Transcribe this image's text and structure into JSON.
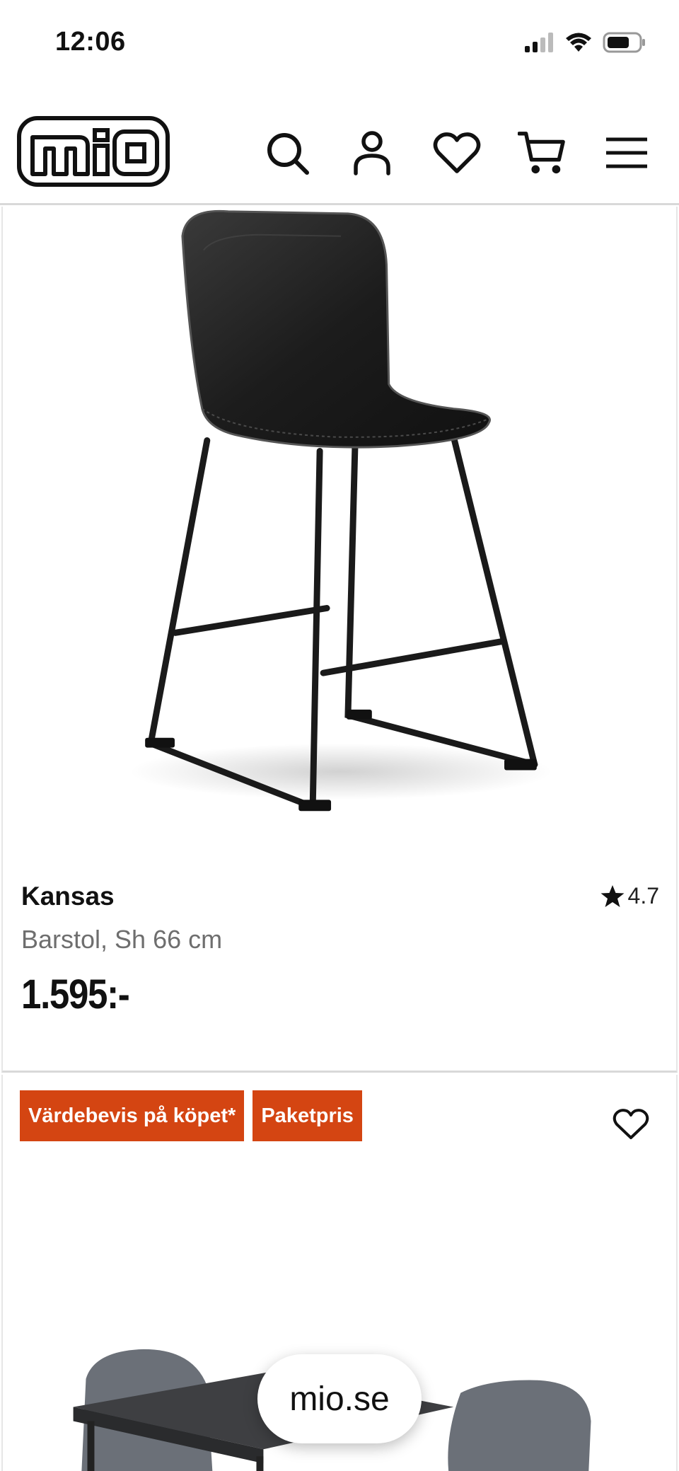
{
  "status_bar": {
    "time": "12:06"
  },
  "header": {
    "logo_text": "mio",
    "icons": [
      "search-icon",
      "account-icon",
      "wishlist-icon",
      "cart-icon",
      "menu-icon"
    ]
  },
  "products": [
    {
      "name": "Kansas",
      "description": "Barstol, Sh 66 cm",
      "price": "1.595:-",
      "rating": "4.7"
    },
    {
      "badges": [
        "Värdebevis på köpet*",
        "Paketpris"
      ]
    }
  ],
  "browser": {
    "url": "mio.se"
  },
  "colors": {
    "badge": "#d44512",
    "text": "#111111",
    "muted": "#6e6e6e"
  }
}
